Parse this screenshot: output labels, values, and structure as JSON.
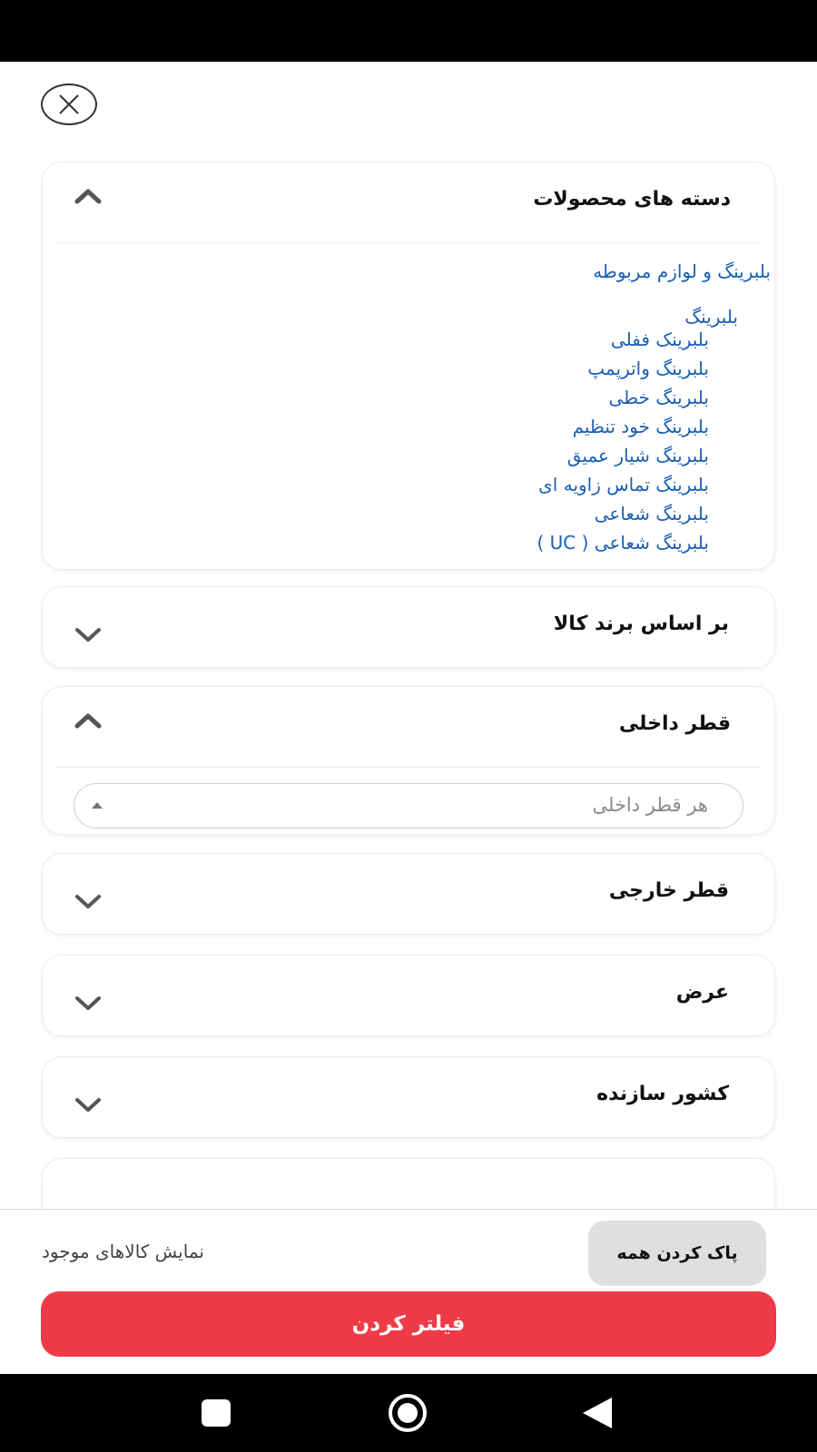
{
  "header": {
    "close_icon": "close-icon"
  },
  "sections": {
    "categories": {
      "title": "دسته های محصولات",
      "expanded": true,
      "items": [
        "بلبرینگ و لوازم مربوطه",
        "بلبرینگ",
        "بلبرینک ففلی",
        "بلبرینگ واترپمپ",
        "بلبرینگ خطی",
        "بلبرینگ خود تنظیم",
        "بلبرینگ شیار عمیق",
        "بلبرینگ تماس زاویه ای",
        "بلبرینگ شعاعی",
        "بلبرینگ شعاعی ( UC )"
      ]
    },
    "brand": {
      "title": "بر اساس برند کالا",
      "expanded": false
    },
    "inner_diameter": {
      "title": "قطر داخلی",
      "expanded": true,
      "select_placeholder": "هر قطر داخلی"
    },
    "outer_diameter": {
      "title": "قطر خارجی",
      "expanded": false
    },
    "width": {
      "title": "عرض",
      "expanded": false
    },
    "country": {
      "title": "کشور سازنده",
      "expanded": false
    }
  },
  "footer": {
    "clear_all": "پاک کردن همه",
    "show_available": "نمایش کالاهای موجود",
    "filter_button": "فیلتر کردن"
  },
  "colors": {
    "link": "#1a5fb4",
    "primary_button": "#ef3b47",
    "secondary_button": "#dfdfdf"
  },
  "nav": {
    "icons": [
      "recent-apps-icon",
      "home-icon",
      "back-icon"
    ]
  }
}
